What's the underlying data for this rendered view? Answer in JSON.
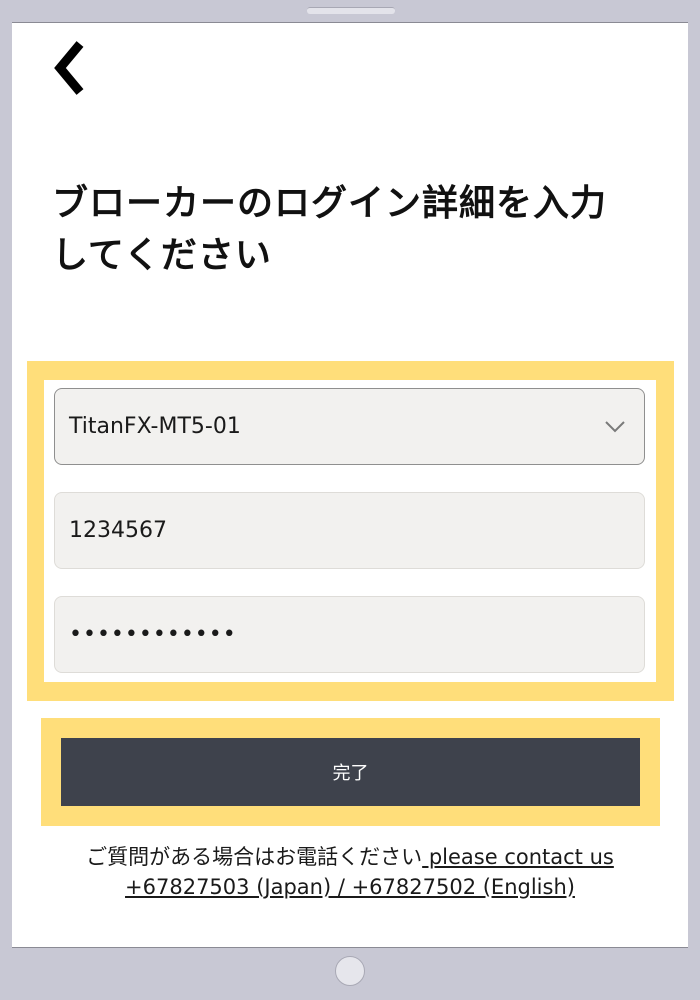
{
  "header": {
    "back_icon": "chevron-left-icon"
  },
  "page": {
    "title": "ブローカーのログイン詳細を入力してください"
  },
  "form": {
    "server": {
      "value": "TitanFX-MT5-01",
      "icon": "chevron-down-icon"
    },
    "account": {
      "value": "1234567"
    },
    "password": {
      "value": "••••••••••••"
    },
    "submit_label": "完了"
  },
  "help": {
    "text": "ご質問がある場合はお電話ください",
    "link": " please contact us +67827503 (Japan) / +67827502 (English)"
  },
  "colors": {
    "highlight": "#ffde7a",
    "button": "#3e424c",
    "field": "#f2f1ef",
    "device": "#c8c8d4"
  }
}
